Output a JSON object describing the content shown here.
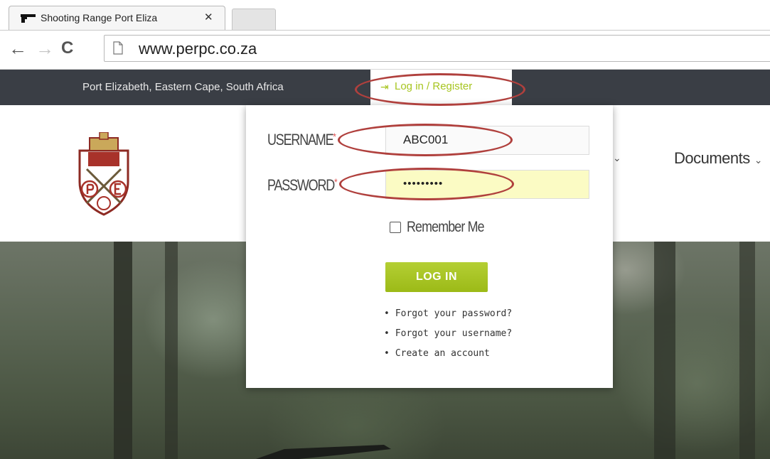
{
  "browser": {
    "tab_title": "Shooting Range Port Eliza",
    "tab_close": "✕",
    "url": "www.perpc.co.za",
    "back": "←",
    "forward": "→",
    "reload": "C"
  },
  "topbar": {
    "location": "Port Elizabeth, Eastern Cape, South Africa",
    "login_label": "Log in / Register",
    "login_icon": "⇥"
  },
  "nav": {
    "documents_label": "Documents",
    "chevron": "⌄"
  },
  "login_form": {
    "username_label": "USERNAME",
    "password_label": "PASSWORD",
    "required_mark": "*",
    "username_value": "ABC001",
    "password_value": "•••••••••",
    "remember_label": "Remember Me",
    "remember_checked": false,
    "submit_label": "LOG IN",
    "links": [
      "Forgot your password?",
      "Forgot your username?",
      "Create an account"
    ],
    "bullet": "•"
  },
  "colors": {
    "accent_green": "#a7c520",
    "topbar_bg": "#3a3e45",
    "password_bg": "#fbfbc4",
    "annotation_red": "#b0403d"
  },
  "icons": {
    "favicon": "gun-icon",
    "page": "page-icon",
    "login": "sign-in-icon",
    "logo": "club-crest-logo"
  }
}
